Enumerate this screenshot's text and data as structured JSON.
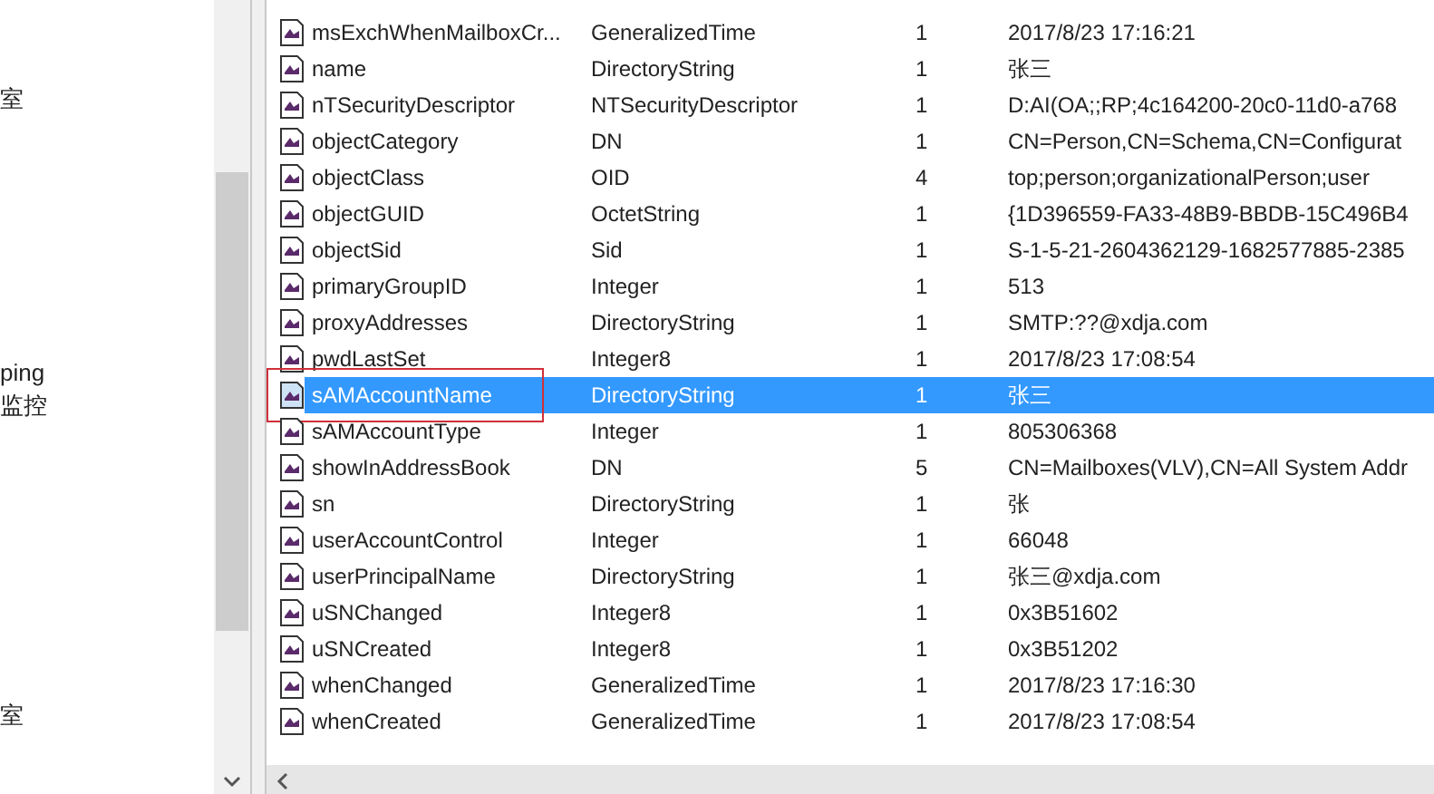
{
  "left_pane": {
    "items": [
      "室",
      "ping",
      "监控",
      "室"
    ]
  },
  "attributes": [
    {
      "name": "msExchWhenMailboxCr...",
      "type": "GeneralizedTime",
      "count": "1",
      "value": "2017/8/23 17:16:21",
      "selected": false,
      "annotated": false
    },
    {
      "name": "name",
      "type": "DirectoryString",
      "count": "1",
      "value": "张三",
      "selected": false,
      "annotated": false
    },
    {
      "name": "nTSecurityDescriptor",
      "type": "NTSecurityDescriptor",
      "count": "1",
      "value": "D:AI(OA;;RP;4c164200-20c0-11d0-a768",
      "selected": false,
      "annotated": false
    },
    {
      "name": "objectCategory",
      "type": "DN",
      "count": "1",
      "value": "CN=Person,CN=Schema,CN=Configurat",
      "selected": false,
      "annotated": false
    },
    {
      "name": "objectClass",
      "type": "OID",
      "count": "4",
      "value": "top;person;organizationalPerson;user",
      "selected": false,
      "annotated": false
    },
    {
      "name": "objectGUID",
      "type": "OctetString",
      "count": "1",
      "value": "{1D396559-FA33-48B9-BBDB-15C496B4",
      "selected": false,
      "annotated": false
    },
    {
      "name": "objectSid",
      "type": "Sid",
      "count": "1",
      "value": "S-1-5-21-2604362129-1682577885-2385",
      "selected": false,
      "annotated": false
    },
    {
      "name": "primaryGroupID",
      "type": "Integer",
      "count": "1",
      "value": "513",
      "selected": false,
      "annotated": false
    },
    {
      "name": "proxyAddresses",
      "type": "DirectoryString",
      "count": "1",
      "value": "SMTP:??@xdja.com",
      "selected": false,
      "annotated": false
    },
    {
      "name": "pwdLastSet",
      "type": "Integer8",
      "count": "1",
      "value": "2017/8/23 17:08:54",
      "selected": false,
      "annotated": false
    },
    {
      "name": "sAMAccountName",
      "type": "DirectoryString",
      "count": "1",
      "value": "张三",
      "selected": true,
      "annotated": true
    },
    {
      "name": "sAMAccountType",
      "type": "Integer",
      "count": "1",
      "value": "805306368",
      "selected": false,
      "annotated": false
    },
    {
      "name": "showInAddressBook",
      "type": "DN",
      "count": "5",
      "value": "CN=Mailboxes(VLV),CN=All System Addr",
      "selected": false,
      "annotated": false
    },
    {
      "name": "sn",
      "type": "DirectoryString",
      "count": "1",
      "value": "张",
      "selected": false,
      "annotated": false
    },
    {
      "name": "userAccountControl",
      "type": "Integer",
      "count": "1",
      "value": "66048",
      "selected": false,
      "annotated": false
    },
    {
      "name": "userPrincipalName",
      "type": "DirectoryString",
      "count": "1",
      "value": "张三@xdja.com",
      "selected": false,
      "annotated": false
    },
    {
      "name": "uSNChanged",
      "type": "Integer8",
      "count": "1",
      "value": "0x3B51602",
      "selected": false,
      "annotated": false
    },
    {
      "name": "uSNCreated",
      "type": "Integer8",
      "count": "1",
      "value": "0x3B51202",
      "selected": false,
      "annotated": false
    },
    {
      "name": "whenChanged",
      "type": "GeneralizedTime",
      "count": "1",
      "value": "2017/8/23 17:16:30",
      "selected": false,
      "annotated": false
    },
    {
      "name": "whenCreated",
      "type": "GeneralizedTime",
      "count": "1",
      "value": "2017/8/23 17:08:54",
      "selected": false,
      "annotated": false
    }
  ]
}
